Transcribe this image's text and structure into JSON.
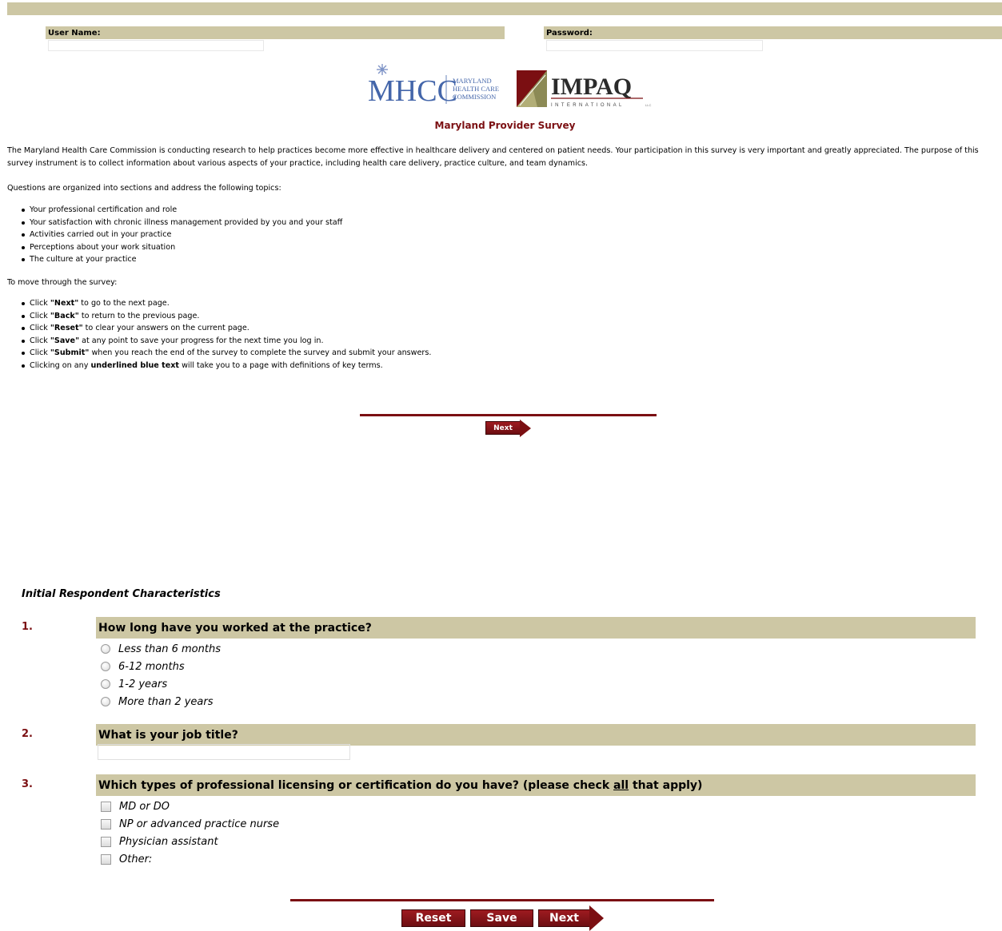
{
  "login": {
    "username_label": "User Name:",
    "password_label": "Password:",
    "username_value": "",
    "password_value": ""
  },
  "logos": {
    "mhcc_letters": "MHCC",
    "mhcc_line1": "MARYLAND",
    "mhcc_line2": "HEALTH CARE",
    "mhcc_line3": "COMMISSION",
    "impaq_name": "IMPAQ",
    "impaq_sub": "INTERNATIONAL",
    "impaq_llc": "LLC",
    "brand_color": "#7b0f12"
  },
  "title": "Maryland Provider Survey",
  "intro": "The Maryland Health Care Commission is conducting research to help practices become more effective in healthcare delivery and centered on patient needs. Your participation in this survey is very important and greatly appreciated. The purpose of this survey instrument is to collect information about various aspects of your practice, including health care delivery, practice culture, and team dynamics.",
  "topics_intro": "Questions are organized into sections and address the following topics:",
  "topics": [
    "Your professional certification and role",
    "Your satisfaction with chronic illness management provided by you and your staff",
    "Activities carried out in your practice",
    "Perceptions about your work situation",
    "The culture at your practice"
  ],
  "nav_intro": "To move through the survey:",
  "nav_items": [
    {
      "pre": "Click ",
      "bold": "\"Next\"",
      "post": " to go to the next page."
    },
    {
      "pre": "Click ",
      "bold": "\"Back\"",
      "post": " to return to the previous page."
    },
    {
      "pre": "Click ",
      "bold": "\"Reset\"",
      "post": " to clear your answers on the current page."
    },
    {
      "pre": "Click ",
      "bold": "\"Save\"",
      "post": " at any point to save your progress for the next time you log in."
    },
    {
      "pre": "Click ",
      "bold": "\"Submit\"",
      "post": " when you reach the end of the survey to complete the survey and submit your answers."
    },
    {
      "pre": "Clicking on any ",
      "bold": "underlined blue text",
      "post": " will take you to a page with definitions of key terms."
    }
  ],
  "top_next_label": "Next",
  "section_title": "Initial Respondent Characteristics",
  "questions": [
    {
      "number": "1.",
      "text": "How long have you worked at the practice?",
      "options": [
        "Less than 6 months",
        "6-12 months",
        "1-2 years",
        "More than 2 years"
      ]
    },
    {
      "number": "2.",
      "text": "What is your job title?",
      "value": ""
    },
    {
      "number": "3.",
      "text_pre": "Which types of professional licensing or certification do you have? (please check ",
      "text_u": "all",
      "text_post": " that apply)",
      "options": [
        "MD or DO",
        "NP or advanced practice nurse",
        "Physician assistant",
        "Other:"
      ]
    }
  ],
  "buttons": {
    "reset": "Reset",
    "save": "Save",
    "next": "Next"
  }
}
